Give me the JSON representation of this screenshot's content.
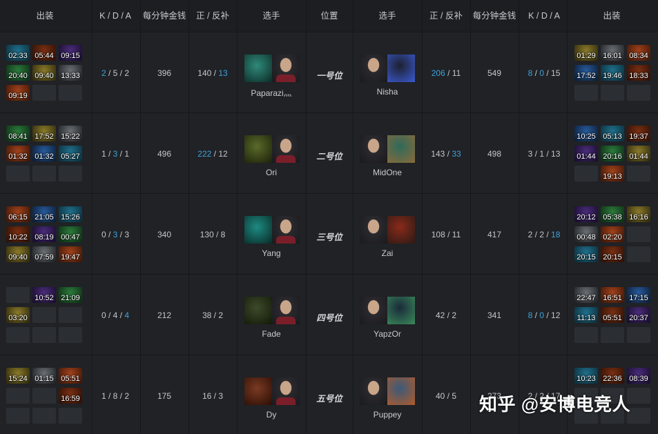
{
  "headers": [
    "出装",
    "K / D / A",
    "每分钟金钱",
    "正 / 反补",
    "选手",
    "位置",
    "选手",
    "正 / 反补",
    "每分钟金钱",
    "K / D / A",
    "出装"
  ],
  "rows": [
    {
      "position": "一号位",
      "left": {
        "player": "Paparazi灬",
        "items": [
          "02:33",
          "05:44",
          "09:15",
          "20:40",
          "09:40",
          "13:33",
          "09:19",
          "",
          ""
        ],
        "kda": {
          "k": "2",
          "d": "5",
          "a": "2",
          "hl": [
            "k"
          ]
        },
        "gpm": {
          "v": "396",
          "hl": false
        },
        "cs": {
          "lh": "140",
          "dn": "13",
          "hl": [
            "dn"
          ]
        }
      },
      "right": {
        "player": "Nisha",
        "items": [
          "01:29",
          "16:01",
          "08:34",
          "17:52",
          "19:46",
          "18:33",
          "",
          "",
          ""
        ],
        "kda": {
          "k": "8",
          "d": "0",
          "a": "15",
          "hl": [
            "k",
            "d"
          ]
        },
        "gpm": {
          "v": "549",
          "hl": true
        },
        "cs": {
          "lh": "206",
          "dn": "11",
          "hl": [
            "lh"
          ]
        }
      }
    },
    {
      "position": "二号位",
      "left": {
        "player": "Ori",
        "items": [
          "08:41",
          "17:52",
          "15:22",
          "01:32",
          "01:32",
          "05:27",
          "",
          "",
          ""
        ],
        "kda": {
          "k": "1",
          "d": "3",
          "a": "1",
          "hl": [
            "d"
          ]
        },
        "gpm": {
          "v": "496",
          "hl": true
        },
        "cs": {
          "lh": "222",
          "dn": "12",
          "hl": [
            "lh"
          ]
        }
      },
      "right": {
        "player": "MidOne",
        "items": [
          "10:25",
          "05:13",
          "19:37",
          "01:44",
          "20:16",
          "01:44",
          "",
          "19:13",
          ""
        ],
        "kda": {
          "k": "3",
          "d": "1",
          "a": "13",
          "hl": []
        },
        "gpm": {
          "v": "498",
          "hl": false
        },
        "cs": {
          "lh": "143",
          "dn": "33",
          "hl": [
            "dn"
          ]
        }
      }
    },
    {
      "position": "三号位",
      "left": {
        "player": "Yang",
        "items": [
          "06:15",
          "21:05",
          "15:26",
          "10:22",
          "08:19",
          "00:47",
          "09:40",
          "07:59",
          "19:47"
        ],
        "kda": {
          "k": "0",
          "d": "3",
          "a": "3",
          "hl": [
            "d"
          ]
        },
        "gpm": {
          "v": "340",
          "hl": false
        },
        "cs": {
          "lh": "130",
          "dn": "8",
          "hl": []
        }
      },
      "right": {
        "player": "Zai",
        "items": [
          "20:12",
          "05:38",
          "16:16",
          "00:48",
          "02:20",
          "",
          "20:15",
          "20:15",
          ""
        ],
        "kda": {
          "k": "2",
          "d": "2",
          "a": "18",
          "hl": [
            "a"
          ]
        },
        "gpm": {
          "v": "417",
          "hl": false
        },
        "cs": {
          "lh": "108",
          "dn": "11",
          "hl": []
        }
      }
    },
    {
      "position": "四号位",
      "left": {
        "player": "Fade",
        "items": [
          "",
          "10:52",
          "21:09",
          "03:20",
          "",
          "",
          "",
          "",
          ""
        ],
        "kda": {
          "k": "0",
          "d": "4",
          "a": "4",
          "hl": [
            "a"
          ]
        },
        "gpm": {
          "v": "212",
          "hl": false
        },
        "cs": {
          "lh": "38",
          "dn": "2",
          "hl": []
        }
      },
      "right": {
        "player": "YapzOr",
        "items": [
          "22:47",
          "16:51",
          "17:15",
          "11:13",
          "05:51",
          "20:37",
          "",
          "",
          ""
        ],
        "kda": {
          "k": "8",
          "d": "0",
          "a": "12",
          "hl": [
            "k",
            "d"
          ]
        },
        "gpm": {
          "v": "341",
          "hl": false
        },
        "cs": {
          "lh": "42",
          "dn": "2",
          "hl": []
        }
      }
    },
    {
      "position": "五号位",
      "left": {
        "player": "Dy",
        "items": [
          "15:24",
          "01:15",
          "05:51",
          "",
          "",
          "16:59",
          "",
          "",
          ""
        ],
        "kda": {
          "k": "1",
          "d": "8",
          "a": "2",
          "hl": []
        },
        "gpm": {
          "v": "175",
          "hl": false
        },
        "cs": {
          "lh": "16",
          "dn": "3",
          "hl": []
        }
      },
      "right": {
        "player": "Puppey",
        "items": [
          "10:23",
          "22:36",
          "08:39",
          "",
          "",
          "",
          "",
          "",
          ""
        ],
        "kda": {
          "k": "2",
          "d": "2",
          "a": "17",
          "hl": []
        },
        "gpm": {
          "v": "273",
          "hl": false
        },
        "cs": {
          "lh": "40",
          "dn": "5",
          "hl": []
        }
      }
    }
  ],
  "watermark": "知乎 @安博电竞人",
  "colors": {
    "highlight": "#3ea3dc",
    "background": "#202226",
    "header": "#1c1e22",
    "divider": "#15171a"
  }
}
